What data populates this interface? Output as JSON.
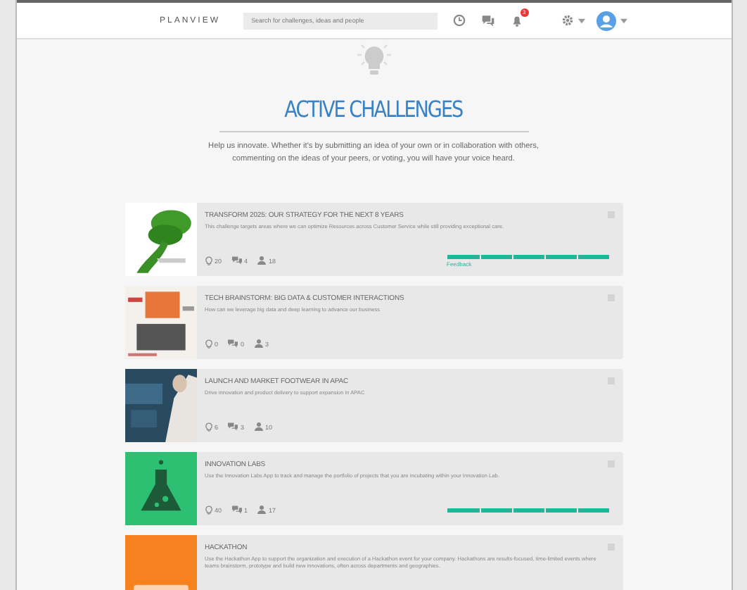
{
  "header": {
    "logo": "PLANVIEW",
    "search": {
      "placeholder": "Search for challenges, ideas and people"
    },
    "notifications_badge": "3"
  },
  "page": {
    "title": "ACTIVE CHALLENGES",
    "intro": "Help us innovate. Whether it's by submitting an idea of your own or in collaboration with others, commenting on the ideas of your peers, or voting, you will have your voice heard."
  },
  "challenges": [
    {
      "title": "TRANSFORM 2025: OUR STRATEGY FOR THE NEXT 8 YEARS",
      "description": "This challenge targets areas where we can optimize Resources across Customer Service while still providing exceptional care.",
      "image": {
        "kind": "tree"
      },
      "ideas": "20",
      "comments": "4",
      "members": "18",
      "progress": {
        "level": 1,
        "label": "Feedback"
      }
    },
    {
      "title": "TECH BRAINSTORM: BIG DATA & CUSTOMER INTERACTIONS",
      "description": "How can we leverage big data and deep learning to advance our business",
      "image": {
        "kind": "cloud"
      },
      "ideas": "0",
      "comments": "0",
      "members": "3"
    },
    {
      "title": "LAUNCH AND MARKET FOOTWEAR IN APAC",
      "description": "Drive innovation and product delivery to support expansion in APAC",
      "ideas": "6",
      "comments": "3",
      "members": "10"
    },
    {
      "title": "INNOVATION LABS",
      "description": "Use the Innovation Labs App to track and manage the portfolio of projects that you are incubating within your Innovation Lab.",
      "image": {
        "kind": "flask"
      },
      "ideas": "40",
      "comments": "1",
      "members": "17",
      "progress": {
        "level": 1
      }
    },
    {
      "title": "HACKATHON",
      "description": "Use the Hackathon App to support the organization and execution of a Hackathon event for your company. Hackathons are results-focused, time-limited events where teams brainstorm, prototype and build new innovations, often across departments and geographies.",
      "image": {
        "kind": "code"
      }
    }
  ]
}
